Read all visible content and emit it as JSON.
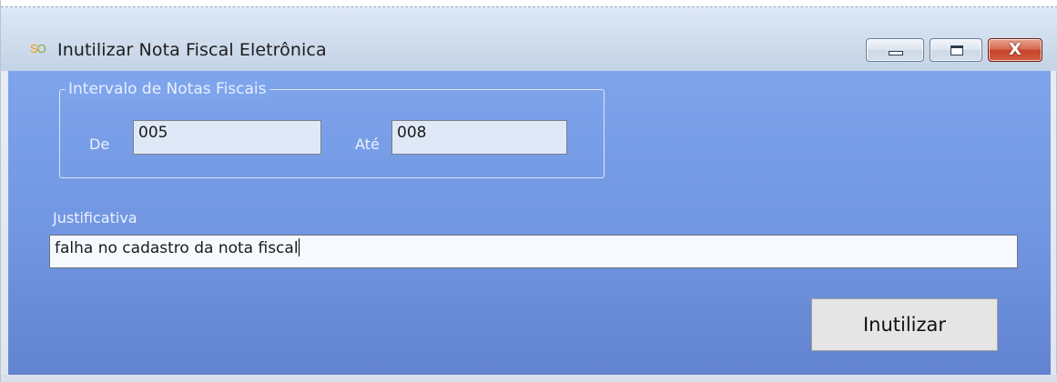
{
  "window": {
    "title": "Inutilizar Nota Fiscal Eletrônica",
    "controls": {
      "minimize_icon": "minimize-icon",
      "maximize_icon": "maximize-icon",
      "close_glyph": "X"
    }
  },
  "interval_group": {
    "legend": "Intervalo de Notas Fiscais",
    "from_label": "De",
    "from_value": "005",
    "to_label": "Até",
    "to_value": "008"
  },
  "justification": {
    "label": "Justificativa",
    "value": "falha no cadastro da nota fiscal"
  },
  "actions": {
    "submit_label": "Inutilizar"
  },
  "colors": {
    "client_background": "#7ea4ec",
    "close_button": "#c6452c"
  }
}
